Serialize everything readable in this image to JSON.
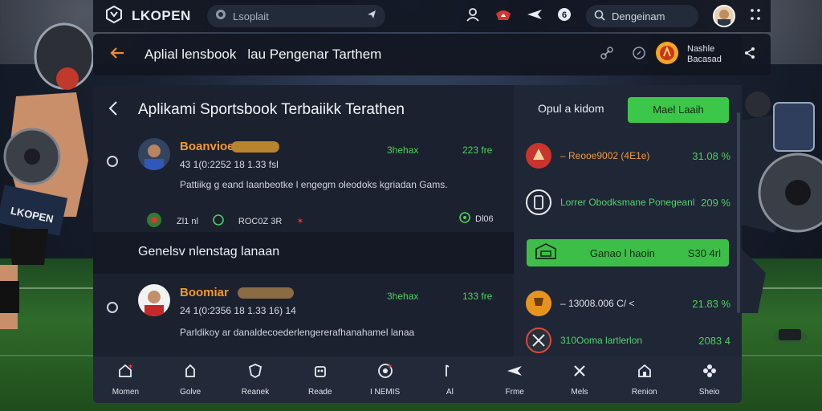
{
  "app": {
    "logo_text": "LKOPEN"
  },
  "topbar": {
    "search_text": "Lsoplait",
    "search2_text": "Dengeinam"
  },
  "header": {
    "title": "Aplial lensbook",
    "subtitle": "lau Pengenar Tarthem"
  },
  "profile": {
    "line1": "Nashle",
    "line2": "Bacasad"
  },
  "main": {
    "title": "Aplikami Sportsbook Terbaiikk Terathen",
    "matches": [
      {
        "name": "Boanvioe",
        "pill": "",
        "odds_a": "3hehax",
        "odds_b": "223 fre",
        "time": "43 1(0:2252 18 1.33 fsl",
        "desc": "Pattiikg g eand laanbeotke l engegm oleodoks kgriadan Gams.",
        "foot_left": "Zl1 nl",
        "foot_mid": "ROC0Z 3R",
        "foot_right": "Dl06"
      },
      {
        "name": "Boomiar",
        "pill": "",
        "odds_a": "3hehax",
        "odds_b": "133 fre",
        "time": "24 1(0:2356 18 1.33 16) 14",
        "desc": "Parldikoy ar danaldecoederlengererafhanahamel lanaa"
      }
    ],
    "section_title": "Genelsv nlenstag lanaan"
  },
  "side": {
    "head_label": "Opul a kidom",
    "cta_label": "Mael Laaih",
    "rows": [
      {
        "label": "– Reooe9002 (4E1e)",
        "value": "31.08 %",
        "label_color": "orange"
      },
      {
        "label": "Lorrer Obodksmane Ponegeanl",
        "value": "209 %",
        "label_color": "mixed"
      },
      {
        "label": "– 13008.006 C/ <",
        "value": "21.83 %",
        "label_color": "white"
      },
      {
        "label": "310Ooma lartlerlon",
        "value": "2083 4",
        "label_color": "green"
      }
    ],
    "green_bar": {
      "label": "Ganao l haoin",
      "value": "S30 4rl"
    }
  },
  "nav": {
    "items": [
      {
        "label": "Momen",
        "icon": "home-icon"
      },
      {
        "label": "Golve",
        "icon": "upload-icon"
      },
      {
        "label": "Reanek",
        "icon": "shield-icon"
      },
      {
        "label": "Reade",
        "icon": "robot-icon"
      },
      {
        "label": "I NEMIS",
        "icon": "target-icon"
      },
      {
        "label": "Al",
        "icon": "phone-icon"
      },
      {
        "label": "Frme",
        "icon": "bird-icon"
      },
      {
        "label": "Mels",
        "icon": "cross-icon"
      },
      {
        "label": "Renion",
        "icon": "house-icon"
      },
      {
        "label": "Sheio",
        "icon": "flower-icon"
      }
    ]
  },
  "colors": {
    "accent_green": "#3dc74a",
    "accent_orange": "#f39a2b",
    "panel": "#1b212e"
  }
}
